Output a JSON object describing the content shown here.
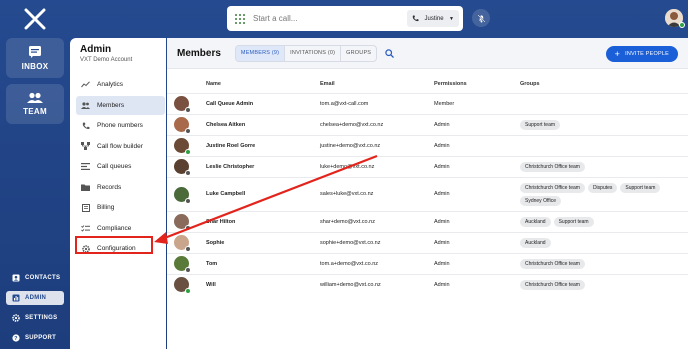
{
  "rail": {
    "inbox_label": "INBOX",
    "team_label": "TEAM",
    "links": [
      {
        "label": "CONTACTS",
        "icon": "contacts-icon"
      },
      {
        "label": "ADMIN",
        "icon": "admin-icon"
      },
      {
        "label": "SETTINGS",
        "icon": "gear-icon"
      },
      {
        "label": "SUPPORT",
        "icon": "help-icon"
      }
    ]
  },
  "callbar": {
    "placeholder": "Start a call...",
    "line_name": "Justine"
  },
  "admin": {
    "title": "Admin",
    "account": "VXT Demo Account",
    "menu": [
      {
        "label": "Analytics"
      },
      {
        "label": "Members"
      },
      {
        "label": "Phone numbers"
      },
      {
        "label": "Call flow builder"
      },
      {
        "label": "Call queues"
      },
      {
        "label": "Records"
      },
      {
        "label": "Billing"
      },
      {
        "label": "Compliance"
      },
      {
        "label": "Configuration"
      }
    ]
  },
  "main": {
    "title": "Members",
    "tabs": [
      "MEMBERS (9)",
      "INVITATIONS (0)",
      "GROUPS"
    ],
    "invite_label": "INVITE PEOPLE",
    "columns": [
      "Name",
      "Email",
      "Permissions",
      "Groups"
    ],
    "rows": [
      {
        "name": "Call Queue Admin",
        "email": "tom.a@vxt-call.com",
        "permission": "Member",
        "groups": []
      },
      {
        "name": "Chelsea Aitken",
        "email": "chelsea+demo@vxt.co.nz",
        "permission": "Admin",
        "groups": [
          "Support team"
        ]
      },
      {
        "name": "Justine Roel Gorre",
        "email": "justine+demo@vxt.co.nz",
        "permission": "Admin",
        "groups": []
      },
      {
        "name": "Leslie Christopher",
        "email": "luke+demo@vxt.co.nz",
        "permission": "Admin",
        "groups": [
          "Christchurch Office team"
        ]
      },
      {
        "name": "Luke Campbell",
        "email": "sales+luke@vxt.co.nz",
        "permission": "Admin",
        "groups": [
          "Christchurch Office team",
          "Disputes",
          "Support team",
          "Sydney Office"
        ]
      },
      {
        "name": "Shar Hilton",
        "email": "shar+demo@vxt.co.nz",
        "permission": "Admin",
        "groups": [
          "Auckland",
          "Support team"
        ]
      },
      {
        "name": "Sophie",
        "email": "sophie+demo@vxt.co.nz",
        "permission": "Admin",
        "groups": [
          "Auckland"
        ]
      },
      {
        "name": "Tom",
        "email": "tom.a+demo@vxt.co.nz",
        "permission": "Admin",
        "groups": [
          "Christchurch Office team"
        ]
      },
      {
        "name": "Will",
        "email": "william+demo@vxt.co.nz",
        "permission": "Admin",
        "groups": [
          "Christchurch Office team"
        ]
      }
    ]
  },
  "colors": {
    "rail": "#254a8f",
    "accent": "#1a5fd8",
    "annotation": "#e3241c",
    "online": "#2ea043",
    "offline": "#555555"
  }
}
